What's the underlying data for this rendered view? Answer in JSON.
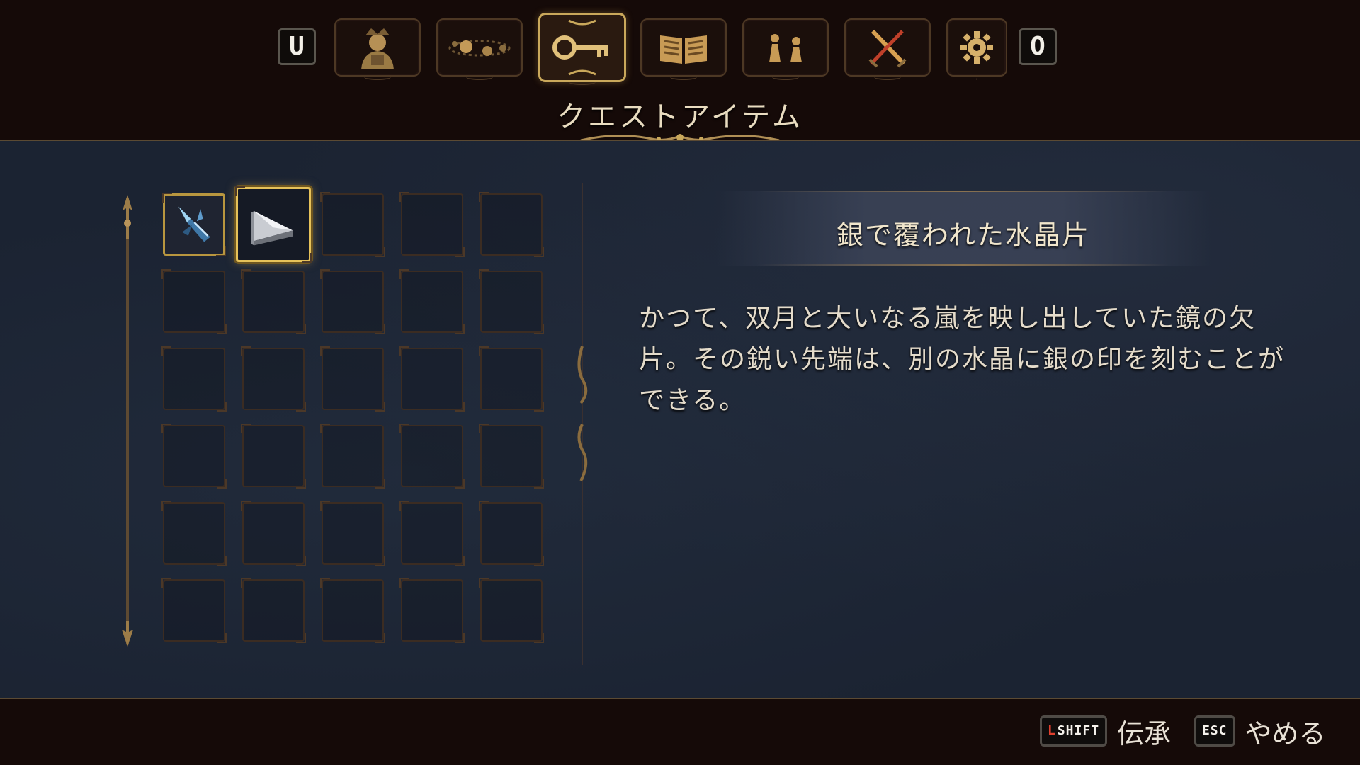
{
  "tabs": {
    "left_key": "U",
    "right_key": "O",
    "items": [
      {
        "icon": "character-bust-icon"
      },
      {
        "icon": "orbit-planets-icon"
      },
      {
        "icon": "key-icon",
        "active": true
      },
      {
        "icon": "open-book-icon"
      },
      {
        "icon": "pawn-figures-icon"
      },
      {
        "icon": "crossed-swords-icon"
      },
      {
        "icon": "gear-icon"
      }
    ]
  },
  "section_title": "クエストアイテム",
  "inventory": {
    "columns": 5,
    "rows": 6,
    "items": [
      {
        "slot": 0,
        "icon": "crystal-shard-icon"
      },
      {
        "slot": 1,
        "icon": "silver-crystal-fragment-icon",
        "selected": true
      }
    ]
  },
  "detail": {
    "name": "銀で覆われた水晶片",
    "description": "かつて、双月と大いなる嵐を映し出していた鏡の欠片。その鋭い先端は、別の水晶に銀の印を刻むことができる。"
  },
  "footer": {
    "hints": [
      {
        "key_prefix": "L",
        "key": "SHIFT",
        "label": "伝承"
      },
      {
        "key_prefix": "",
        "key": "ESC",
        "label": "やめる"
      }
    ]
  },
  "colors": {
    "gold": "#c9a85b",
    "panel": "#1b2332",
    "frame": "#150a08"
  }
}
